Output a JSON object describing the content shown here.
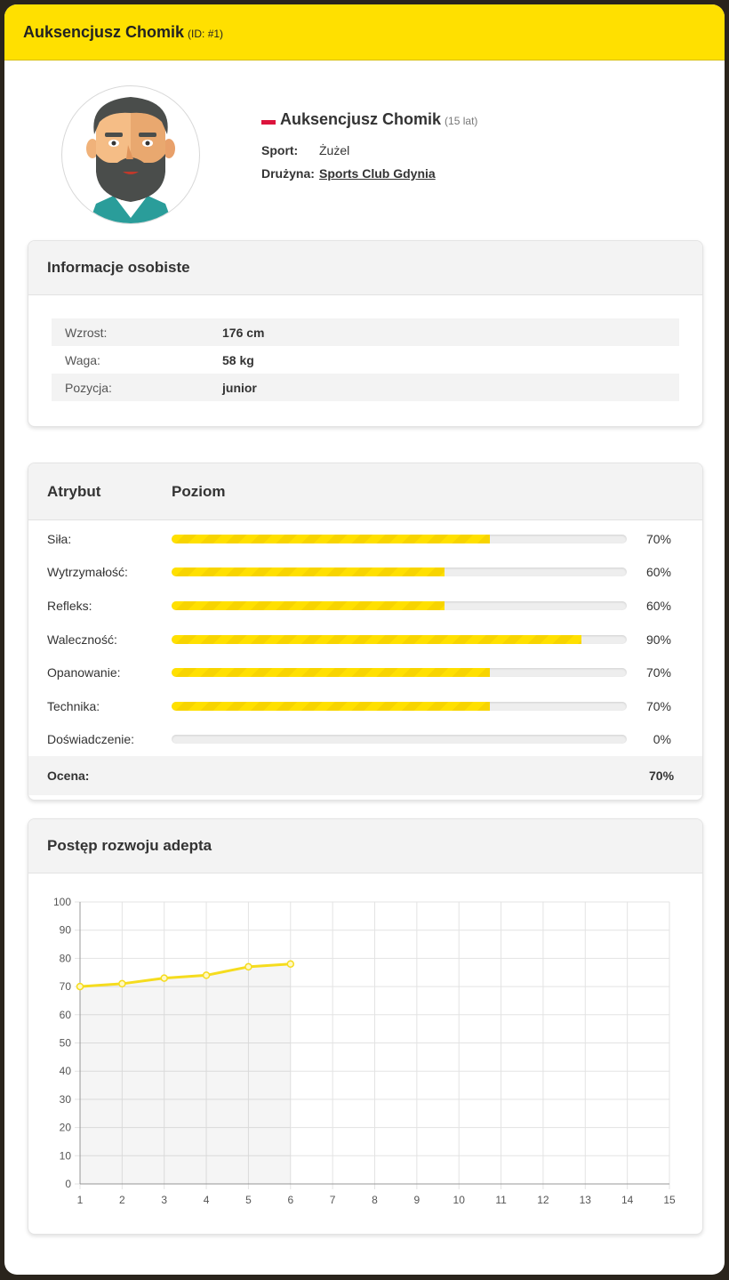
{
  "header": {
    "name": "Auksencjusz Chomik",
    "id": "(ID: #1)"
  },
  "profile": {
    "name": "Auksencjusz Chomik",
    "age": "(15 lat)",
    "sport_label": "Sport:",
    "sport": "Żużel",
    "team_label": "Drużyna:",
    "team": "Sports Club Gdynia"
  },
  "personal": {
    "title": "Informacje osobiste",
    "rows": [
      {
        "label": "Wzrost:",
        "value": "176 cm"
      },
      {
        "label": "Waga:",
        "value": "58 kg"
      },
      {
        "label": "Pozycja:",
        "value": "junior"
      }
    ]
  },
  "attributes": {
    "col1": "Atrybut",
    "col2": "Poziom",
    "rows": [
      {
        "label": "Siła:",
        "value": 70,
        "text": "70%"
      },
      {
        "label": "Wytrzymałość:",
        "value": 60,
        "text": "60%"
      },
      {
        "label": "Refleks:",
        "value": 60,
        "text": "60%"
      },
      {
        "label": "Waleczność:",
        "value": 90,
        "text": "90%"
      },
      {
        "label": "Opanowanie:",
        "value": 70,
        "text": "70%"
      },
      {
        "label": "Technika:",
        "value": 70,
        "text": "70%"
      },
      {
        "label": "Doświadczenie:",
        "value": 0,
        "text": "0%"
      }
    ],
    "rating_label": "Ocena:",
    "rating": "70%"
  },
  "progress": {
    "title": "Postęp rozwoju adepta"
  },
  "colors": {
    "accent": "#ffe000",
    "line": "#f5dc1e"
  },
  "chart_data": {
    "type": "line",
    "x": [
      1,
      2,
      3,
      4,
      5,
      6
    ],
    "y": [
      70,
      71,
      73,
      74,
      77,
      78
    ],
    "xlim": [
      1,
      15
    ],
    "ylim": [
      0,
      100
    ],
    "xticks": [
      1,
      2,
      3,
      4,
      5,
      6,
      7,
      8,
      9,
      10,
      11,
      12,
      13,
      14,
      15
    ],
    "yticks": [
      0,
      10,
      20,
      30,
      40,
      50,
      60,
      70,
      80,
      90,
      100
    ],
    "grid": true,
    "fill": true
  }
}
